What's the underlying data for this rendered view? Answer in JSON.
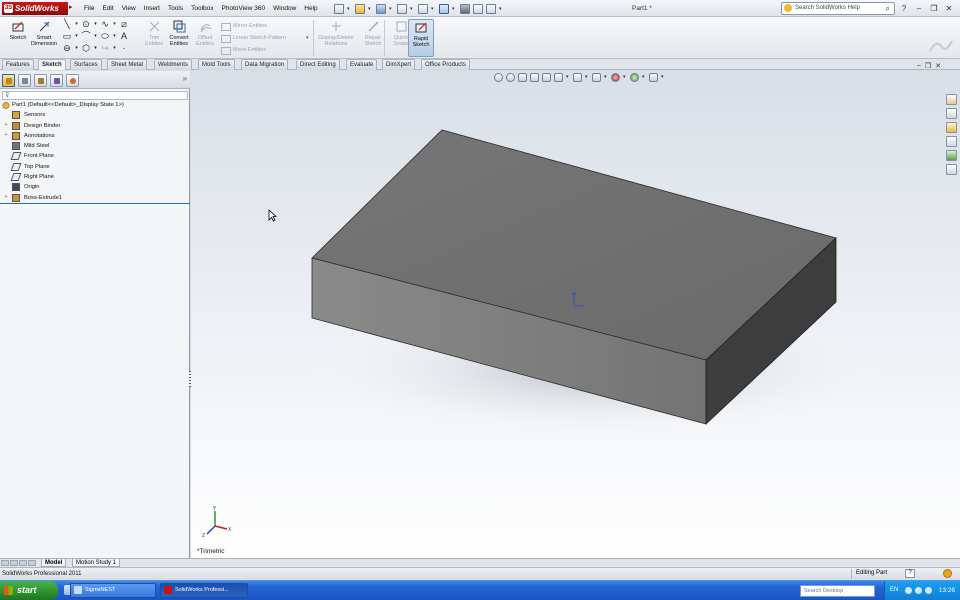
{
  "app": {
    "logo_text": "SolidWorks",
    "menu": [
      "File",
      "Edit",
      "View",
      "Insert",
      "Tools",
      "Toolbox",
      "PhotoView 360",
      "Window",
      "Help"
    ],
    "document_title": "Part1 *",
    "help_search_placeholder": "Search SolidWorks Help"
  },
  "command_manager": {
    "sketch": "Sketch",
    "smart_dimension_1": "Smart",
    "smart_dimension_2": "Dimension",
    "trim_1": "Trim",
    "trim_2": "Entities",
    "convert_1": "Convert",
    "convert_2": "Entities",
    "offset_1": "Offset",
    "offset_2": "Entities",
    "mirror_entities": "Mirror Entities",
    "linear_pattern": "Linear Sketch Pattern",
    "move_entities": "Move Entities",
    "display_delete_1": "Display/Delete",
    "display_delete_2": "Relations",
    "repair_1": "Repair",
    "repair_2": "Sketch",
    "quick_snaps_1": "Quick",
    "quick_snaps_2": "Snaps",
    "rapid_sketch_1": "Rapid",
    "rapid_sketch_2": "Sketch"
  },
  "tabs": [
    "Features",
    "Sketch",
    "Surfaces",
    "Sheet Metal",
    "Weldments",
    "Mold Tools",
    "Data Migration",
    "Direct Editing",
    "Evaluate",
    "DimXpert",
    "Office Products"
  ],
  "active_tab": "Sketch",
  "feature_tree": {
    "root": "Part1  (Default<<Default>_Display State 1>)",
    "items": [
      {
        "label": "Sensors",
        "icon": "sensors-icon",
        "expand": ""
      },
      {
        "label": "Design Binder",
        "icon": "design-binder-icon",
        "expand": "+"
      },
      {
        "label": "Annotations",
        "icon": "annotations-icon",
        "expand": "+"
      },
      {
        "label": "Mild Steel",
        "icon": "material-icon",
        "expand": ""
      },
      {
        "label": "Front Plane",
        "icon": "plane-icon",
        "expand": ""
      },
      {
        "label": "Top Plane",
        "icon": "plane-icon",
        "expand": ""
      },
      {
        "label": "Right Plane",
        "icon": "plane-icon",
        "expand": ""
      },
      {
        "label": "Origin",
        "icon": "origin-icon",
        "expand": ""
      },
      {
        "label": "Boss-Extrude1",
        "icon": "extrude-icon",
        "expand": "+"
      }
    ]
  },
  "viewport": {
    "view_orientation": "*Trimetric",
    "model_color": "#6f6f6f"
  },
  "bottom_tabs": [
    "Model",
    "Motion Study 1"
  ],
  "status": {
    "left": "SolidWorks Professional 2011",
    "mode": "Editing Part",
    "help": "?"
  },
  "taskbar": {
    "start": "start",
    "items": [
      "SigmaNEST",
      "SolidWorks Professi..."
    ],
    "desktop_search": "Search Desktop",
    "language": "EN",
    "clock": "13:26"
  },
  "colors": {
    "accent": "#2f6cc0",
    "logo_red": "#c41414",
    "taskbar_blue": "#2466d6"
  }
}
